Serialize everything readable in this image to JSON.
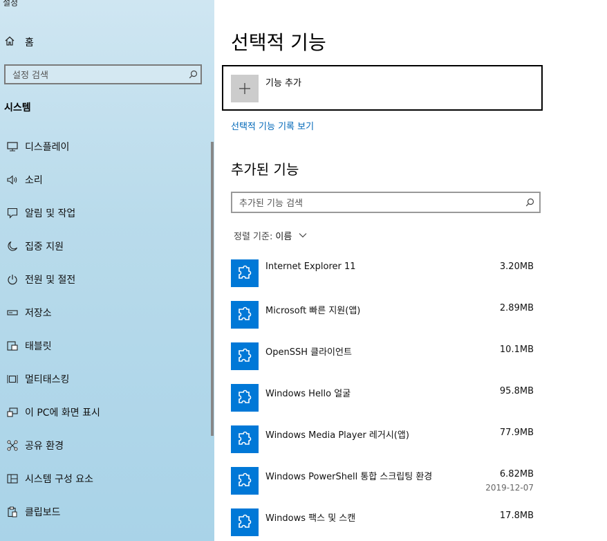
{
  "app": {
    "title": "설정"
  },
  "sidebar": {
    "home_label": "홈",
    "search_placeholder": "설정 검색",
    "section_title": "시스템",
    "items": [
      {
        "label": "디스플레이",
        "icon": "monitor-icon"
      },
      {
        "label": "소리",
        "icon": "speaker-icon"
      },
      {
        "label": "알림 및 작업",
        "icon": "notification-icon"
      },
      {
        "label": "집중 지원",
        "icon": "moon-icon"
      },
      {
        "label": "전원 및 절전",
        "icon": "power-icon"
      },
      {
        "label": "저장소",
        "icon": "storage-icon"
      },
      {
        "label": "태블릿",
        "icon": "tablet-icon"
      },
      {
        "label": "멀티태스킹",
        "icon": "multitasking-icon"
      },
      {
        "label": "이 PC에 화면 표시",
        "icon": "project-icon"
      },
      {
        "label": "공유 환경",
        "icon": "share-icon"
      },
      {
        "label": "시스템 구성 요소",
        "icon": "components-icon"
      },
      {
        "label": "클립보드",
        "icon": "clipboard-icon"
      }
    ]
  },
  "main": {
    "title": "선택적 기능",
    "add_feature_label": "기능 추가",
    "history_link": "선택적 기능 기록 보기",
    "installed_title": "추가된 기능",
    "search_placeholder": "추가된 기능 검색",
    "sort_label": "정렬 기준:",
    "sort_value": "이름",
    "features": [
      {
        "name": "Internet Explorer 11",
        "size": "3.20MB",
        "date": ""
      },
      {
        "name": "Microsoft 빠른 지원(앱)",
        "size": "2.89MB",
        "date": ""
      },
      {
        "name": "OpenSSH 클라이언트",
        "size": "10.1MB",
        "date": ""
      },
      {
        "name": "Windows Hello 얼굴",
        "size": "95.8MB",
        "date": ""
      },
      {
        "name": "Windows Media Player 레거시(앱)",
        "size": "77.9MB",
        "date": ""
      },
      {
        "name": "Windows PowerShell 통합 스크립팅 환경",
        "size": "6.82MB",
        "date": "2019-12-07"
      },
      {
        "name": "Windows 팩스 및 스캔",
        "size": "17.8MB",
        "date": ""
      }
    ]
  },
  "colors": {
    "accent": "#0078d7",
    "link": "#0067b8"
  }
}
